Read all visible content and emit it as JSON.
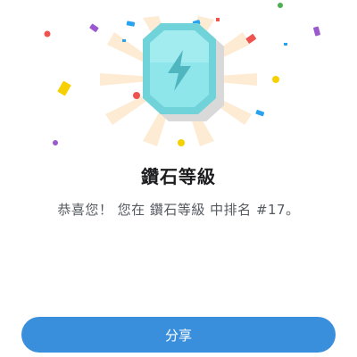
{
  "badge": {
    "icon": "lightning-bolt-icon",
    "tier_color": "#7fe0e4"
  },
  "title": "鑽石等級",
  "message": "恭喜您！ 您在 鑽石等級 中排名 #17。",
  "share_label": "分享",
  "colors": {
    "accent": "#3a8fdc",
    "badge_face": "#8fe6ea",
    "badge_rim": "#6fd3d9"
  }
}
